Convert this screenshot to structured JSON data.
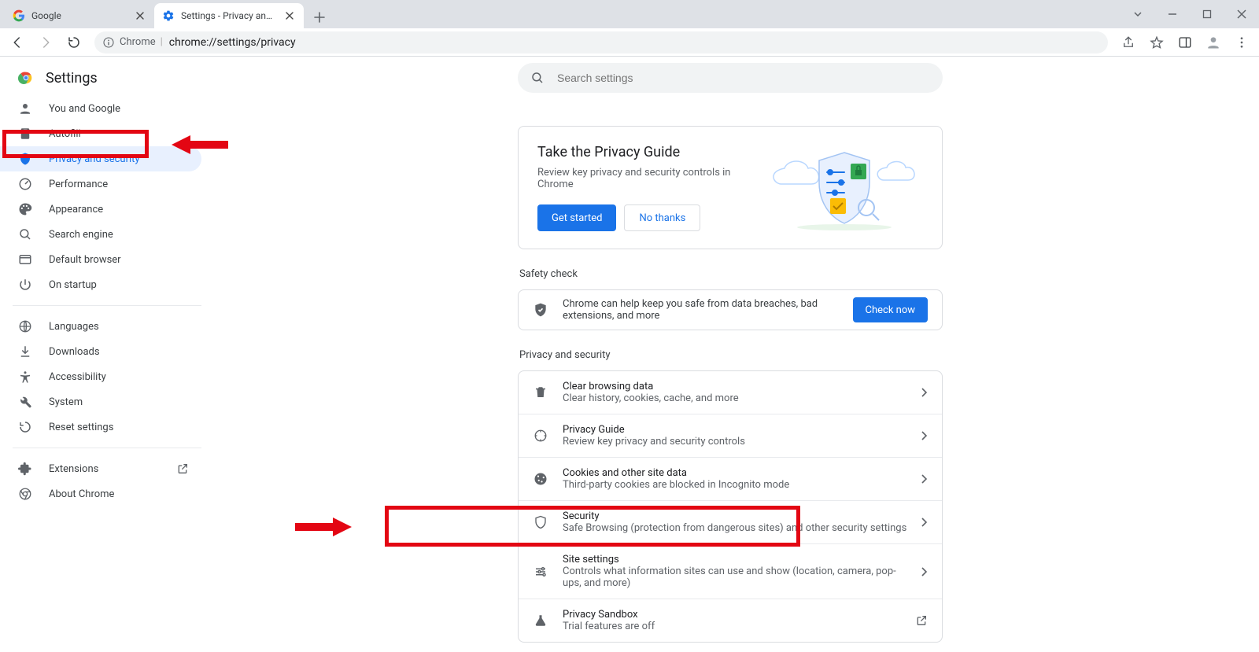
{
  "tabs": [
    {
      "title": "Google"
    },
    {
      "title": "Settings - Privacy and security"
    }
  ],
  "omnibox": {
    "chip": "Chrome",
    "url": "chrome://settings/privacy"
  },
  "app_title": "Settings",
  "search": {
    "placeholder": "Search settings"
  },
  "sidebar": {
    "items": [
      {
        "label": "You and Google"
      },
      {
        "label": "Autofill"
      },
      {
        "label": "Privacy and security"
      },
      {
        "label": "Performance"
      },
      {
        "label": "Appearance"
      },
      {
        "label": "Search engine"
      },
      {
        "label": "Default browser"
      },
      {
        "label": "On startup"
      }
    ],
    "adv_items": [
      {
        "label": "Languages"
      },
      {
        "label": "Downloads"
      },
      {
        "label": "Accessibility"
      },
      {
        "label": "System"
      },
      {
        "label": "Reset settings"
      }
    ],
    "footer_items": [
      {
        "label": "Extensions"
      },
      {
        "label": "About Chrome"
      }
    ]
  },
  "guide": {
    "title": "Take the Privacy Guide",
    "subtitle": "Review key privacy and security controls in Chrome",
    "primary_btn": "Get started",
    "secondary_btn": "No thanks"
  },
  "safety": {
    "section_label": "Safety check",
    "message": "Chrome can help keep you safe from data breaches, bad extensions, and more",
    "button": "Check now"
  },
  "privsec": {
    "section_label": "Privacy and security",
    "rows": [
      {
        "title": "Clear browsing data",
        "sub": "Clear history, cookies, cache, and more"
      },
      {
        "title": "Privacy Guide",
        "sub": "Review key privacy and security controls"
      },
      {
        "title": "Cookies and other site data",
        "sub": "Third-party cookies are blocked in Incognito mode"
      },
      {
        "title": "Security",
        "sub": "Safe Browsing (protection from dangerous sites) and other security settings"
      },
      {
        "title": "Site settings",
        "sub": "Controls what information sites can use and show (location, camera, pop-ups, and more)"
      },
      {
        "title": "Privacy Sandbox",
        "sub": "Trial features are off"
      }
    ]
  }
}
